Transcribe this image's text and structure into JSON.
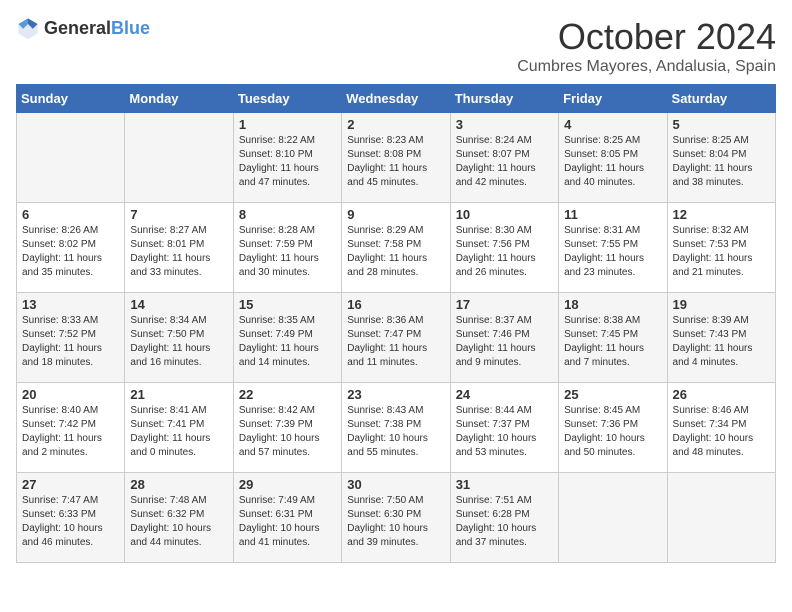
{
  "header": {
    "logo": {
      "general": "General",
      "blue": "Blue"
    },
    "title": "October 2024",
    "location": "Cumbres Mayores, Andalusia, Spain"
  },
  "days_of_week": [
    "Sunday",
    "Monday",
    "Tuesday",
    "Wednesday",
    "Thursday",
    "Friday",
    "Saturday"
  ],
  "weeks": [
    [
      {
        "day": "",
        "sunrise": "",
        "sunset": "",
        "daylight": ""
      },
      {
        "day": "",
        "sunrise": "",
        "sunset": "",
        "daylight": ""
      },
      {
        "day": "1",
        "sunrise": "Sunrise: 8:22 AM",
        "sunset": "Sunset: 8:10 PM",
        "daylight": "Daylight: 11 hours and 47 minutes."
      },
      {
        "day": "2",
        "sunrise": "Sunrise: 8:23 AM",
        "sunset": "Sunset: 8:08 PM",
        "daylight": "Daylight: 11 hours and 45 minutes."
      },
      {
        "day": "3",
        "sunrise": "Sunrise: 8:24 AM",
        "sunset": "Sunset: 8:07 PM",
        "daylight": "Daylight: 11 hours and 42 minutes."
      },
      {
        "day": "4",
        "sunrise": "Sunrise: 8:25 AM",
        "sunset": "Sunset: 8:05 PM",
        "daylight": "Daylight: 11 hours and 40 minutes."
      },
      {
        "day": "5",
        "sunrise": "Sunrise: 8:25 AM",
        "sunset": "Sunset: 8:04 PM",
        "daylight": "Daylight: 11 hours and 38 minutes."
      }
    ],
    [
      {
        "day": "6",
        "sunrise": "Sunrise: 8:26 AM",
        "sunset": "Sunset: 8:02 PM",
        "daylight": "Daylight: 11 hours and 35 minutes."
      },
      {
        "day": "7",
        "sunrise": "Sunrise: 8:27 AM",
        "sunset": "Sunset: 8:01 PM",
        "daylight": "Daylight: 11 hours and 33 minutes."
      },
      {
        "day": "8",
        "sunrise": "Sunrise: 8:28 AM",
        "sunset": "Sunset: 7:59 PM",
        "daylight": "Daylight: 11 hours and 30 minutes."
      },
      {
        "day": "9",
        "sunrise": "Sunrise: 8:29 AM",
        "sunset": "Sunset: 7:58 PM",
        "daylight": "Daylight: 11 hours and 28 minutes."
      },
      {
        "day": "10",
        "sunrise": "Sunrise: 8:30 AM",
        "sunset": "Sunset: 7:56 PM",
        "daylight": "Daylight: 11 hours and 26 minutes."
      },
      {
        "day": "11",
        "sunrise": "Sunrise: 8:31 AM",
        "sunset": "Sunset: 7:55 PM",
        "daylight": "Daylight: 11 hours and 23 minutes."
      },
      {
        "day": "12",
        "sunrise": "Sunrise: 8:32 AM",
        "sunset": "Sunset: 7:53 PM",
        "daylight": "Daylight: 11 hours and 21 minutes."
      }
    ],
    [
      {
        "day": "13",
        "sunrise": "Sunrise: 8:33 AM",
        "sunset": "Sunset: 7:52 PM",
        "daylight": "Daylight: 11 hours and 18 minutes."
      },
      {
        "day": "14",
        "sunrise": "Sunrise: 8:34 AM",
        "sunset": "Sunset: 7:50 PM",
        "daylight": "Daylight: 11 hours and 16 minutes."
      },
      {
        "day": "15",
        "sunrise": "Sunrise: 8:35 AM",
        "sunset": "Sunset: 7:49 PM",
        "daylight": "Daylight: 11 hours and 14 minutes."
      },
      {
        "day": "16",
        "sunrise": "Sunrise: 8:36 AM",
        "sunset": "Sunset: 7:47 PM",
        "daylight": "Daylight: 11 hours and 11 minutes."
      },
      {
        "day": "17",
        "sunrise": "Sunrise: 8:37 AM",
        "sunset": "Sunset: 7:46 PM",
        "daylight": "Daylight: 11 hours and 9 minutes."
      },
      {
        "day": "18",
        "sunrise": "Sunrise: 8:38 AM",
        "sunset": "Sunset: 7:45 PM",
        "daylight": "Daylight: 11 hours and 7 minutes."
      },
      {
        "day": "19",
        "sunrise": "Sunrise: 8:39 AM",
        "sunset": "Sunset: 7:43 PM",
        "daylight": "Daylight: 11 hours and 4 minutes."
      }
    ],
    [
      {
        "day": "20",
        "sunrise": "Sunrise: 8:40 AM",
        "sunset": "Sunset: 7:42 PM",
        "daylight": "Daylight: 11 hours and 2 minutes."
      },
      {
        "day": "21",
        "sunrise": "Sunrise: 8:41 AM",
        "sunset": "Sunset: 7:41 PM",
        "daylight": "Daylight: 11 hours and 0 minutes."
      },
      {
        "day": "22",
        "sunrise": "Sunrise: 8:42 AM",
        "sunset": "Sunset: 7:39 PM",
        "daylight": "Daylight: 10 hours and 57 minutes."
      },
      {
        "day": "23",
        "sunrise": "Sunrise: 8:43 AM",
        "sunset": "Sunset: 7:38 PM",
        "daylight": "Daylight: 10 hours and 55 minutes."
      },
      {
        "day": "24",
        "sunrise": "Sunrise: 8:44 AM",
        "sunset": "Sunset: 7:37 PM",
        "daylight": "Daylight: 10 hours and 53 minutes."
      },
      {
        "day": "25",
        "sunrise": "Sunrise: 8:45 AM",
        "sunset": "Sunset: 7:36 PM",
        "daylight": "Daylight: 10 hours and 50 minutes."
      },
      {
        "day": "26",
        "sunrise": "Sunrise: 8:46 AM",
        "sunset": "Sunset: 7:34 PM",
        "daylight": "Daylight: 10 hours and 48 minutes."
      }
    ],
    [
      {
        "day": "27",
        "sunrise": "Sunrise: 7:47 AM",
        "sunset": "Sunset: 6:33 PM",
        "daylight": "Daylight: 10 hours and 46 minutes."
      },
      {
        "day": "28",
        "sunrise": "Sunrise: 7:48 AM",
        "sunset": "Sunset: 6:32 PM",
        "daylight": "Daylight: 10 hours and 44 minutes."
      },
      {
        "day": "29",
        "sunrise": "Sunrise: 7:49 AM",
        "sunset": "Sunset: 6:31 PM",
        "daylight": "Daylight: 10 hours and 41 minutes."
      },
      {
        "day": "30",
        "sunrise": "Sunrise: 7:50 AM",
        "sunset": "Sunset: 6:30 PM",
        "daylight": "Daylight: 10 hours and 39 minutes."
      },
      {
        "day": "31",
        "sunrise": "Sunrise: 7:51 AM",
        "sunset": "Sunset: 6:28 PM",
        "daylight": "Daylight: 10 hours and 37 minutes."
      },
      {
        "day": "",
        "sunrise": "",
        "sunset": "",
        "daylight": ""
      },
      {
        "day": "",
        "sunrise": "",
        "sunset": "",
        "daylight": ""
      }
    ]
  ]
}
